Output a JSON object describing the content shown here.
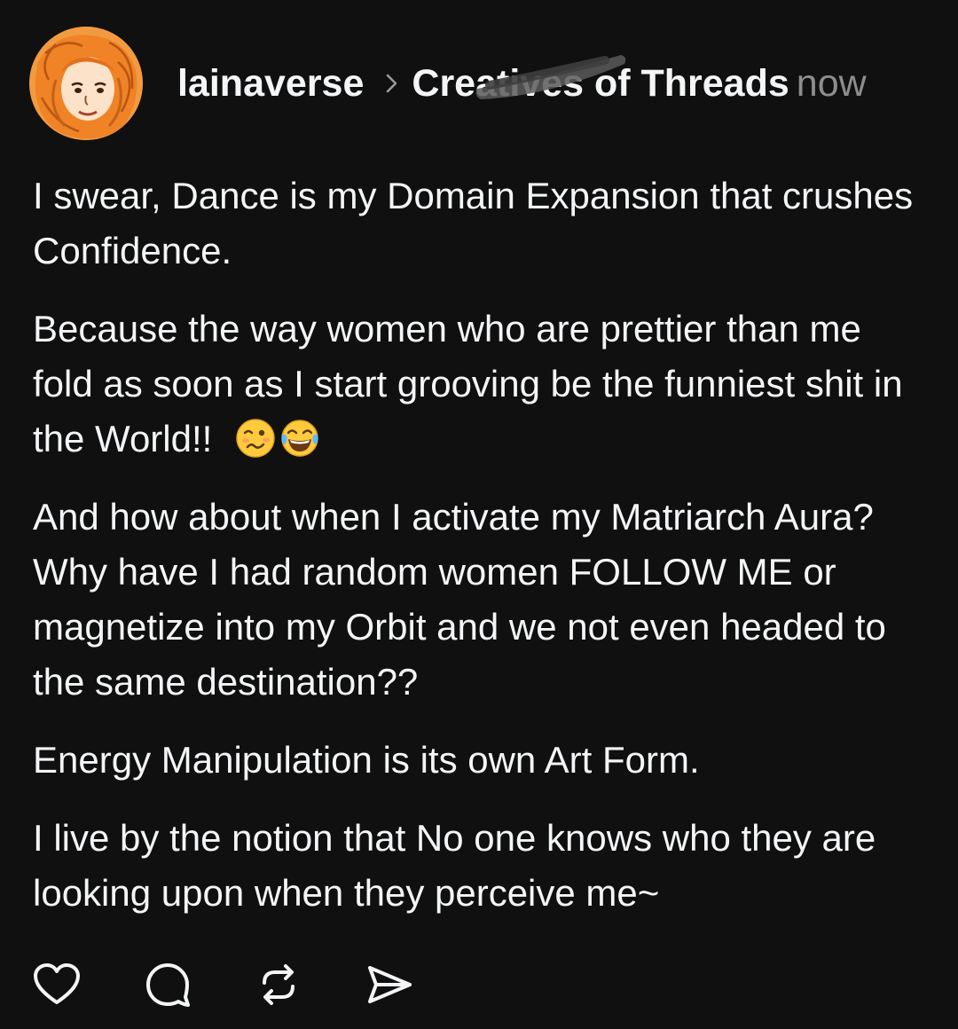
{
  "post": {
    "author": "lainaverse",
    "community": "Creatives of Threads",
    "timestamp": "now",
    "paragraphs": [
      "I swear, Dance is my Domain Expansion that crushes Confidence.",
      "Because the way women who are prettier than me fold as soon as I start grooving be the funniest shit in the World!!",
      "And how about when I activate my Matriarch Aura? Why have I had random women FOLLOW ME or magnetize into my Orbit and we not even headed to the same destination??",
      "Energy Manipulation is its own Art Form.",
      "I live by the notion that No one knows who they are looking upon when they perceive me~"
    ],
    "emojis": [
      "woozy-face",
      "tears-of-joy-face"
    ]
  },
  "actions": {
    "like": "heart-icon",
    "comment": "comment-bubble-icon",
    "repost": "repost-icon",
    "share": "send-icon"
  },
  "colors": {
    "background": "#101010",
    "text": "#f3f5f7",
    "muted": "#8d8d8d",
    "avatar_orange": "#ef8a2e"
  }
}
